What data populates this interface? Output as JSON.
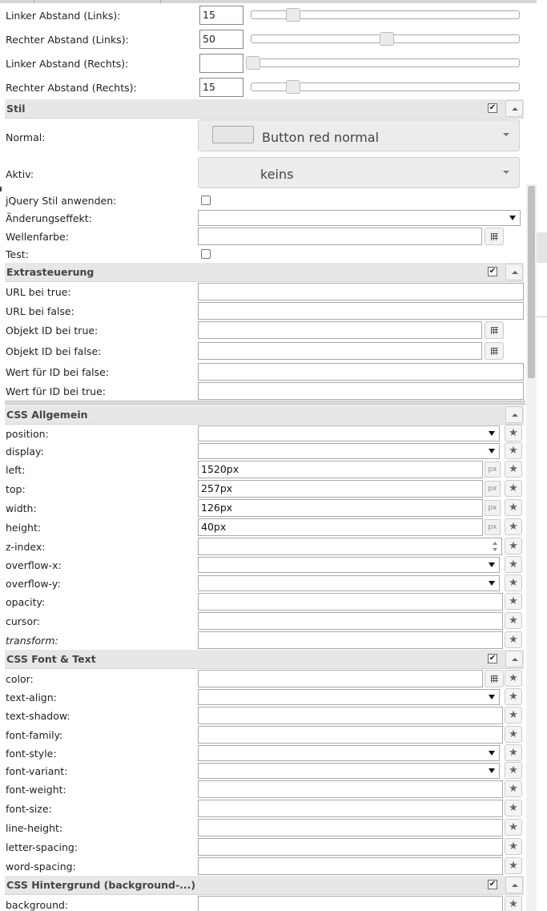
{
  "margins": {
    "left_links": {
      "label": "Linker Abstand (Links):",
      "value": "15",
      "level": 0.12
    },
    "right_links": {
      "label": "Rechter Abstand (Links):",
      "value": "50",
      "level": 0.5
    },
    "left_rechts": {
      "label": "Linker Abstand (Rechts):",
      "value": "",
      "level": 0.0
    },
    "right_rechts": {
      "label": "Rechter Abstand (Rechts):",
      "value": "15",
      "level": 0.12
    }
  },
  "stil": {
    "title": "Stil",
    "normal_label": "Normal:",
    "normal_value": "Button red normal",
    "aktiv_label": "Aktiv:",
    "aktiv_value": "keins",
    "jquery_label": "jQuery Stil anwenden:",
    "effekt_label": "Änderungseffekt:",
    "wellenfarbe_label": "Wellenfarbe:",
    "test_label": "Test:"
  },
  "extra": {
    "title": "Extrasteuerung",
    "url_true": "URL bei true:",
    "url_false": "URL bei false:",
    "obj_true": "Objekt ID bei true:",
    "obj_false": "Objekt ID bei false:",
    "wert_false": "Wert für ID bei false:",
    "wert_true": "Wert für ID bei true:"
  },
  "css_allgemein": {
    "title": "CSS Allgemein",
    "position": "position:",
    "display": "display:",
    "left": "left:",
    "left_value": "1520px",
    "top": "top:",
    "top_value": "257px",
    "width": "width:",
    "width_value": "126px",
    "height": "height:",
    "height_value": "40px",
    "zindex": "z-index:",
    "overflow_x": "overflow-x:",
    "overflow_y": "overflow-y:",
    "opacity": "opacity:",
    "cursor": "cursor:",
    "transform": "transform:",
    "unit": "px"
  },
  "css_font": {
    "title": "CSS Font & Text",
    "color": "color:",
    "text_align": "text-align:",
    "text_shadow": "text-shadow:",
    "font_family": "font-family:",
    "font_style": "font-style:",
    "font_variant": "font-variant:",
    "font_weight": "font-weight:",
    "font_size": "font-size:",
    "line_height": "line-height:",
    "letter_spacing": "letter-spacing:",
    "word_spacing": "word-spacing:"
  },
  "css_bg": {
    "title": "CSS Hintergrund (background-...)",
    "background": "background:"
  },
  "icons": {
    "star": "★",
    "check": "✔"
  }
}
